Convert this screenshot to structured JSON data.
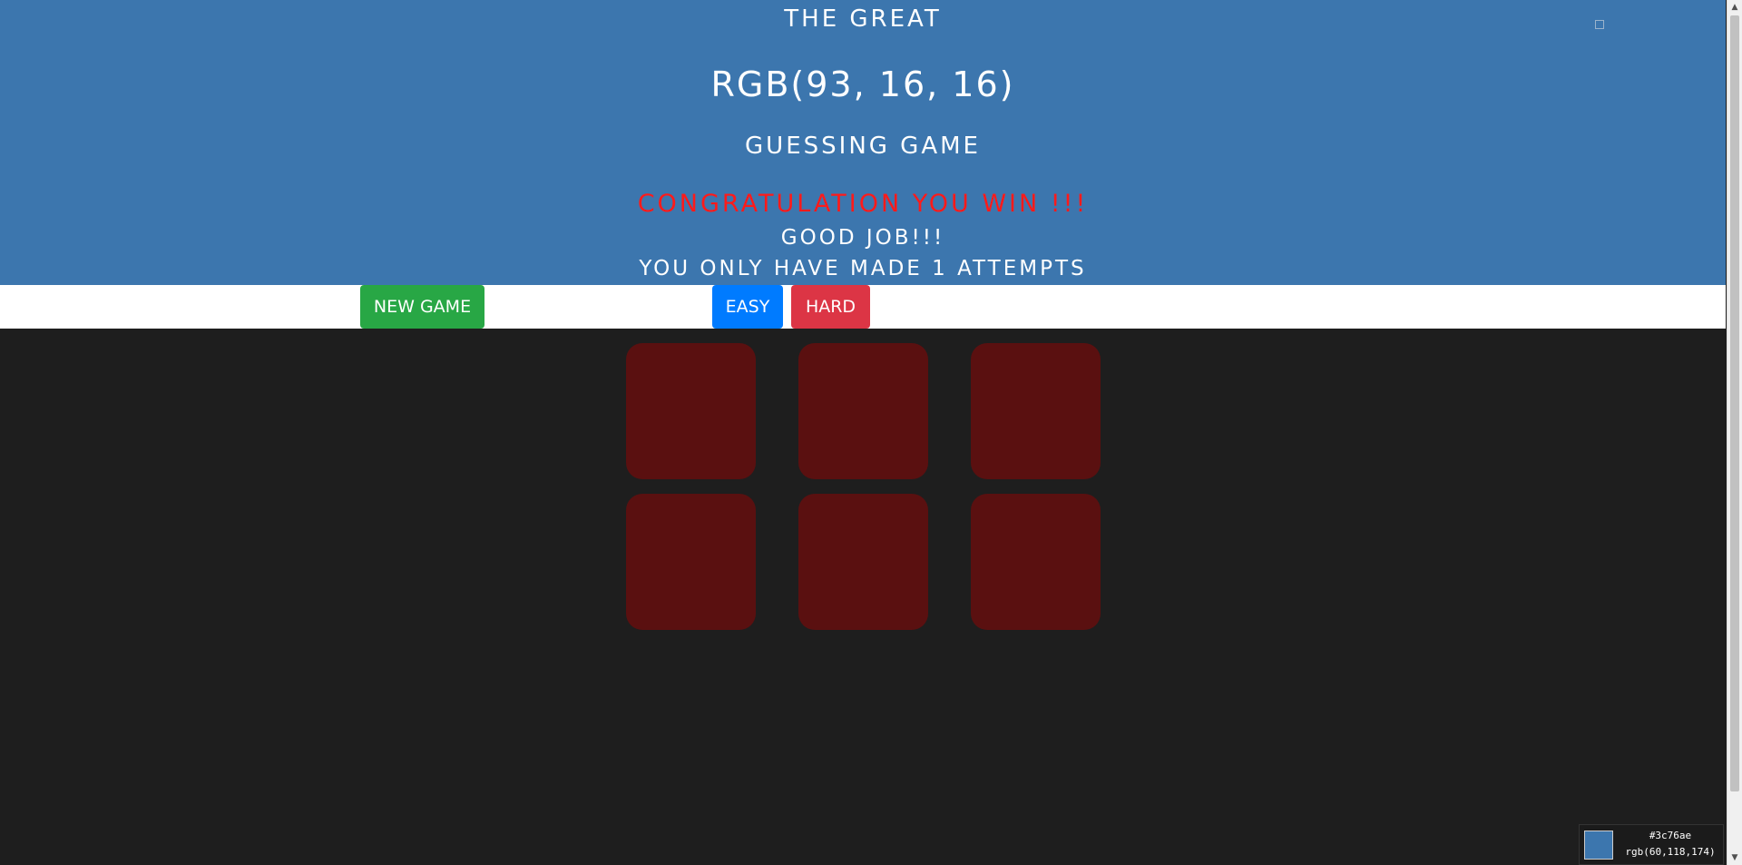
{
  "header": {
    "title_top": "THE GREAT",
    "rgb_value": "RGB(93, 16, 16)",
    "title_bottom": "GUESSING GAME",
    "win_message": "CONGRATULATION YOU WIN !!!",
    "good_job": "GOOD JOB!!!",
    "attempts": "YOU ONLY HAVE MADE 1 ATTEMPTS"
  },
  "toolbar": {
    "new_game_label": "NEW GAME",
    "easy_label": "EASY",
    "hard_label": "HARD"
  },
  "board": {
    "squares": [
      {
        "color": "#5a1010"
      },
      {
        "color": "#5a1010"
      },
      {
        "color": "#5a1010"
      },
      {
        "color": "#5a1010"
      },
      {
        "color": "#5a1010"
      },
      {
        "color": "#5a1010"
      }
    ]
  },
  "picker": {
    "swatch_color": "#3c76ae",
    "hex": "#3c76ae",
    "rgb": "rgb(60,118,174)"
  },
  "colors": {
    "header_bg": "#3c76ae",
    "page_bg": "#1e1e1e",
    "win_text": "#ff1a1a",
    "new_game": "#28a745",
    "easy": "#007bff",
    "hard": "#dc3545"
  },
  "icons": {
    "scroll_up": "▲",
    "scroll_down": "▼"
  }
}
